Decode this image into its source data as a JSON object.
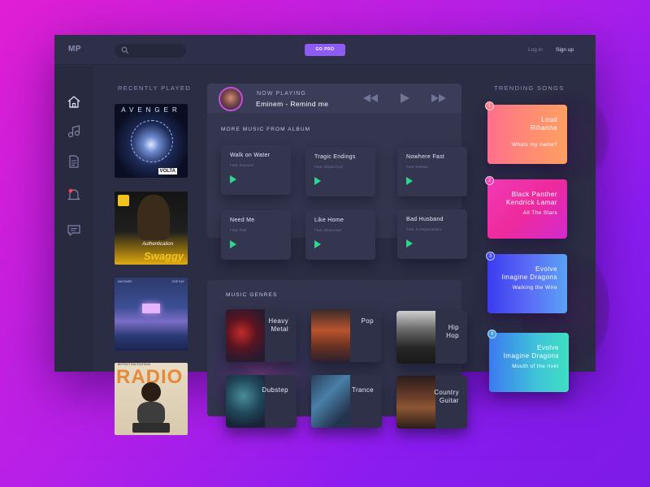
{
  "app": {
    "logo": "MP"
  },
  "header": {
    "search_placeholder": "",
    "go_pro": "GO PRO",
    "login": "Log in",
    "signup": "Sign up"
  },
  "sidebar": {
    "icons": [
      "home-icon",
      "music-notes-icon",
      "document-icon",
      "notification-icon",
      "chat-icon"
    ]
  },
  "recently_played": {
    "title": "RECENTLY PLAYED",
    "albums": [
      {
        "name": "AVENGER",
        "badge": "VOLTA"
      },
      {
        "name": "Swaggy",
        "sub": "Authentication"
      },
      {
        "name": "",
        "caption_left": "MAGNARE",
        "caption_right": "ONE DAY"
      },
      {
        "name": "RADIO",
        "sub": "BEFFECTION STATIONS"
      }
    ]
  },
  "now_playing": {
    "label": "NOW PLAYING",
    "song": "Eminem - Remind me"
  },
  "more_music": {
    "title": "MORE MUSIC FROM ALBUM",
    "tracks": [
      {
        "name": "Walk on Water",
        "feat": "Feat. Beyoncé"
      },
      {
        "name": "Tragic Endings",
        "feat": "Feat. Skylar Grey"
      },
      {
        "name": "Nowhere Fast",
        "feat": "Feat. Kehlani"
      },
      {
        "name": "Need Me",
        "feat": "Feat. Pink"
      },
      {
        "name": "Like Home",
        "feat": "Feat. Alicia Keys"
      },
      {
        "name": "Bad Husband",
        "feat": "Feat. X Ambassadors"
      }
    ]
  },
  "genres": {
    "title": "MUSIC GENRES",
    "items": [
      {
        "line1": "Heavy",
        "line2": "Metal"
      },
      {
        "line1": "Pop",
        "line2": ""
      },
      {
        "line1": "Hip",
        "line2": "Hop"
      },
      {
        "line1": "Dubstep",
        "line2": ""
      },
      {
        "line1": "Trance",
        "line2": ""
      },
      {
        "line1": "Country",
        "line2": "Guitar"
      }
    ]
  },
  "trending": {
    "title": "TRENDING SONGS",
    "items": [
      {
        "num": "1",
        "song": "Loud",
        "artist": "Rihanna",
        "track": "Whats my name?"
      },
      {
        "num": "2",
        "song": "Black Panther",
        "artist": "Kendrick Lamar",
        "track": "All The Stars"
      },
      {
        "num": "3",
        "song": "Evolve",
        "artist": "Imagine Dragons",
        "track": "Walking the Wire"
      },
      {
        "num": "4",
        "song": "Evolve",
        "artist": "Imagine Dragons",
        "track": "Mouth of the river"
      }
    ]
  },
  "colors": {
    "accent": "#8f5bf5",
    "play": "#29d98e",
    "panel": "#34364f"
  }
}
